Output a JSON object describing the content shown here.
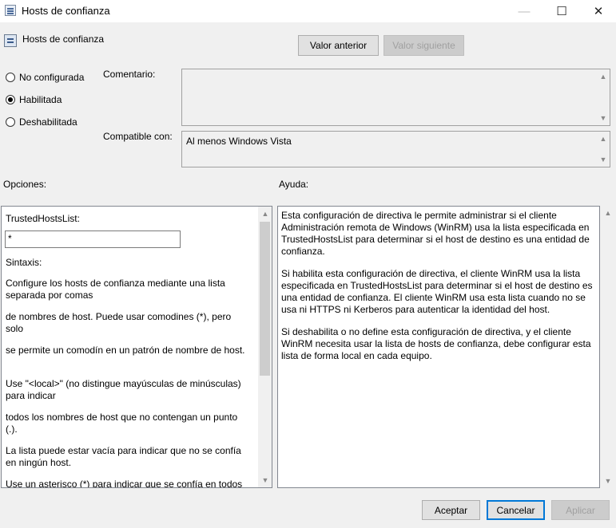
{
  "window": {
    "title": "Hosts de confianza",
    "minimize_glyph": "—",
    "maximize_glyph": "☐",
    "close_glyph": "✕"
  },
  "header": {
    "title": "Hosts de confianza",
    "prev_button": "Valor anterior",
    "next_button": "Valor siguiente"
  },
  "state": {
    "options": [
      {
        "label": "No configurada",
        "checked": false
      },
      {
        "label": "Habilitada",
        "checked": true
      },
      {
        "label": "Deshabilitada",
        "checked": false
      }
    ]
  },
  "comment": {
    "label": "Comentario:",
    "value": ""
  },
  "supported": {
    "label": "Compatible con:",
    "value": "Al menos Windows Vista"
  },
  "options_section": {
    "label": "Opciones:",
    "field_label": "TrustedHostsList:",
    "field_value": "*",
    "lines": [
      "Sintaxis:",
      "Configure los hosts de confianza mediante una lista separada por comas",
      "de nombres de host. Puede usar comodines (*), pero solo",
      "se permite un comodín en un patrón de nombre de host.",
      "Use \"<local>\" (no distingue mayúsculas de minúsculas) para indicar",
      "todos los nombres de host que no contengan un punto (.).",
      "La lista puede estar vacía para indicar que no se confía en ningún host.",
      "Use un asterisco (*) para indicar que se confía en todos"
    ]
  },
  "help_section": {
    "label": "Ayuda:",
    "paragraphs": [
      "Esta configuración de directiva le permite administrar si el cliente Administración remota de Windows (WinRM) usa la lista especificada en TrustedHostsList para determinar si el host de destino es una entidad de confianza.",
      "Si habilita esta configuración de directiva, el cliente WinRM usa la lista especificada en TrustedHostsList para determinar si el host de destino es una entidad de confianza. El cliente WinRM usa esta lista cuando no se usa ni HTTPS ni Kerberos para autenticar la identidad del host.",
      "Si deshabilita o no define esta configuración de directiva, y el cliente WinRM necesita usar la lista de hosts de confianza, debe configurar esta lista de forma local en cada equipo."
    ]
  },
  "footer": {
    "ok": "Aceptar",
    "cancel": "Cancelar",
    "apply": "Aplicar"
  },
  "icons": {
    "scroll_up": "▲",
    "scroll_down": "▼"
  }
}
